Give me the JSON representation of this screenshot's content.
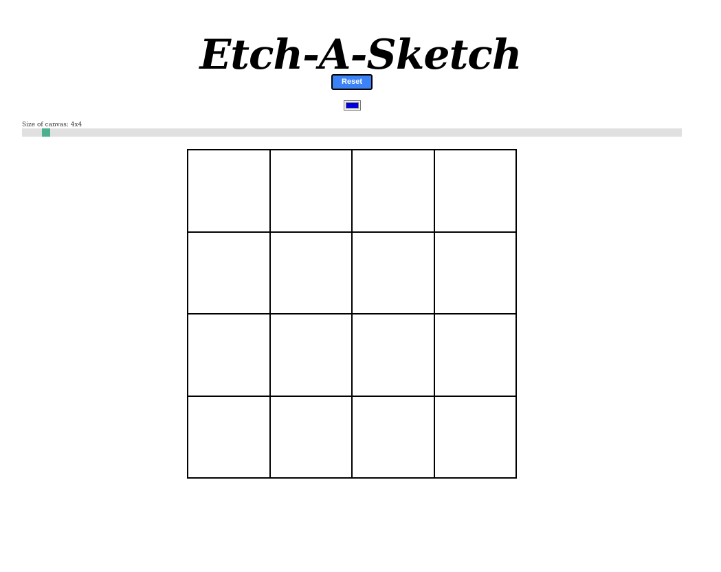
{
  "header": {
    "title": "Etch-A-Sketch"
  },
  "controls": {
    "reset_label": "Reset",
    "pen_color": "#0000dd",
    "size_label": "Size of canvas: 4x4",
    "size_value": 4,
    "size_min": 1,
    "size_max": 100
  },
  "canvas": {
    "rows": 4,
    "columns": 4,
    "cell_color": "#ffffff",
    "border_color": "#000000"
  },
  "colors": {
    "accent": "#3b82f6",
    "slider_thumb": "#4caf8e",
    "slider_track": "#e0e0e0"
  }
}
